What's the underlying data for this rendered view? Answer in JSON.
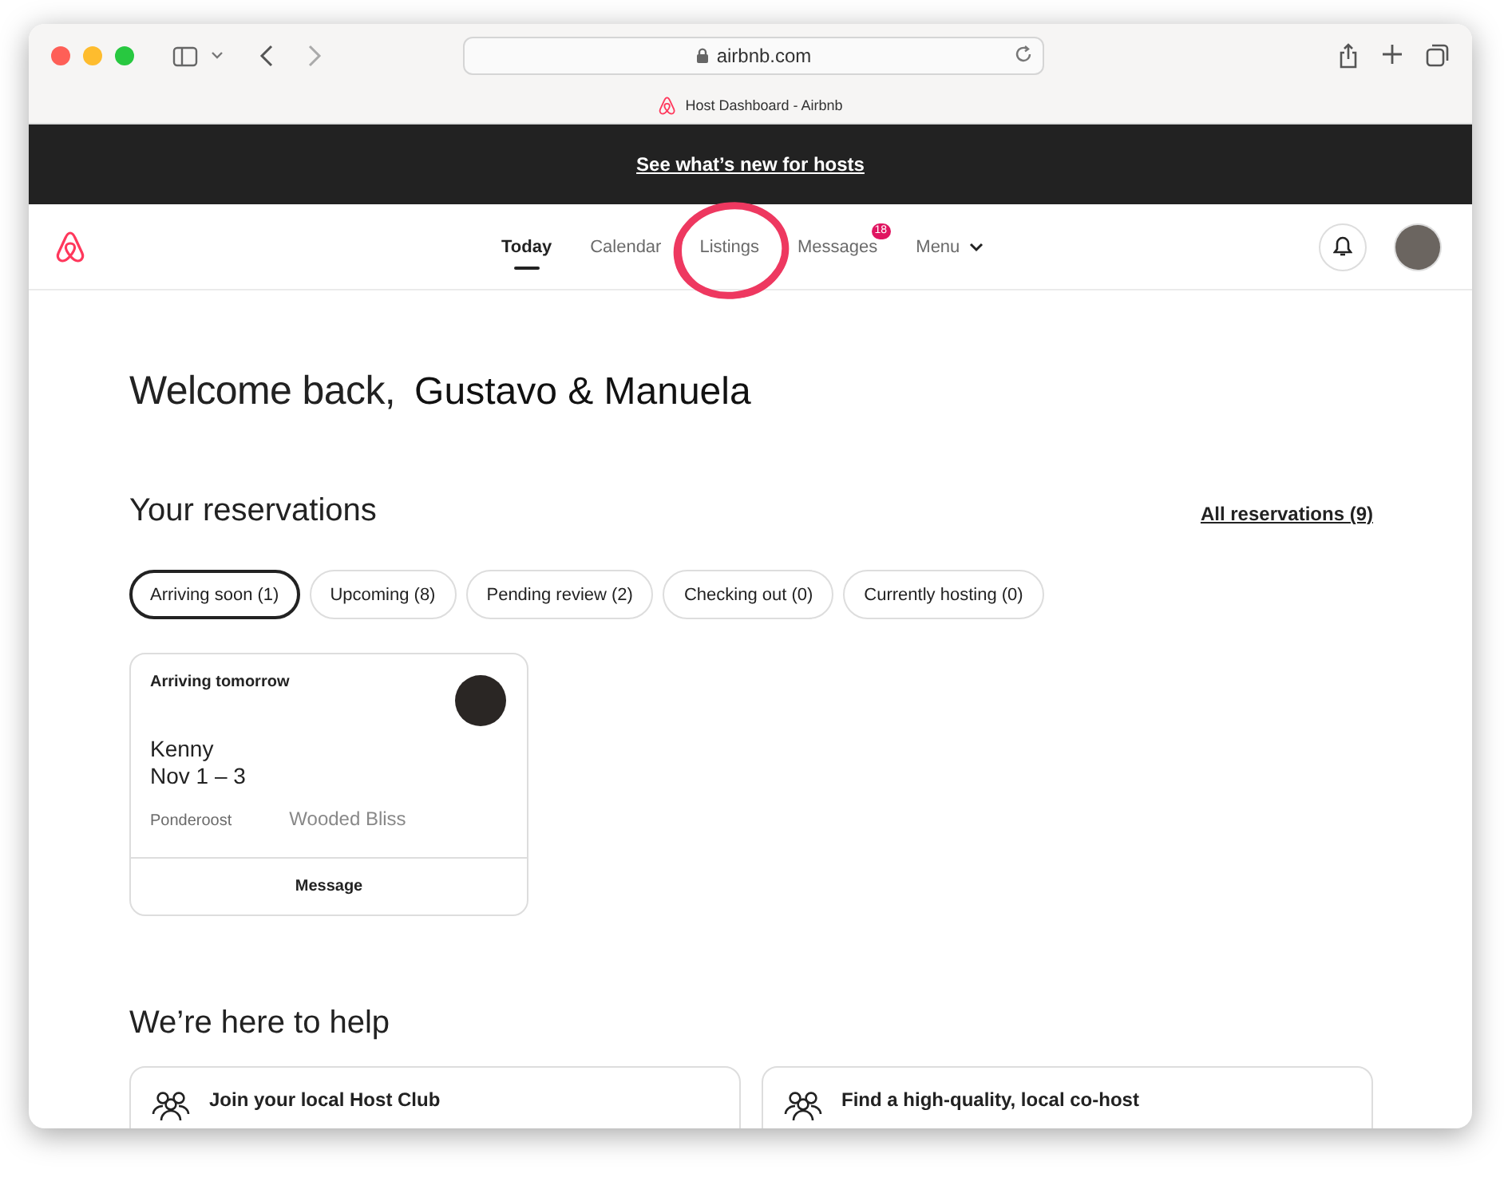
{
  "browser": {
    "address": "airbnb.com",
    "tab_title": "Host Dashboard - Airbnb"
  },
  "banner": {
    "link": "See what’s new for hosts"
  },
  "nav": {
    "items": [
      {
        "label": "Today",
        "kind": "link",
        "selected": true,
        "circled": false
      },
      {
        "label": "Calendar",
        "kind": "link",
        "selected": false,
        "circled": false
      },
      {
        "label": "Listings",
        "kind": "link",
        "selected": false,
        "circled": true
      },
      {
        "label": "Messages",
        "kind": "link",
        "selected": false,
        "circled": false,
        "badge": "18"
      },
      {
        "label": "Menu",
        "kind": "menu",
        "selected": false,
        "circled": false
      }
    ]
  },
  "welcome": {
    "greeting": "Welcome back,",
    "name": "Gustavo & Manuela"
  },
  "reservations": {
    "title": "Your reservations",
    "all_link": "All reservations (9)",
    "filters": [
      {
        "label": "Arriving soon (1)",
        "selected": true
      },
      {
        "label": "Upcoming (8)",
        "selected": false
      },
      {
        "label": "Pending review (2)",
        "selected": false
      },
      {
        "label": "Checking out (0)",
        "selected": false
      },
      {
        "label": "Currently hosting (0)",
        "selected": false
      }
    ],
    "cards": [
      {
        "status": "Arriving tomorrow",
        "guest": "Kenny",
        "dates": "Nov 1 – 3",
        "listing": "Ponderoost",
        "note": "Wooded Bliss",
        "action": "Message"
      }
    ]
  },
  "help": {
    "title": "We’re here to help",
    "cards": [
      {
        "title": "Join your local Host Club"
      },
      {
        "title": "Find a high-quality, local co-host"
      }
    ]
  }
}
